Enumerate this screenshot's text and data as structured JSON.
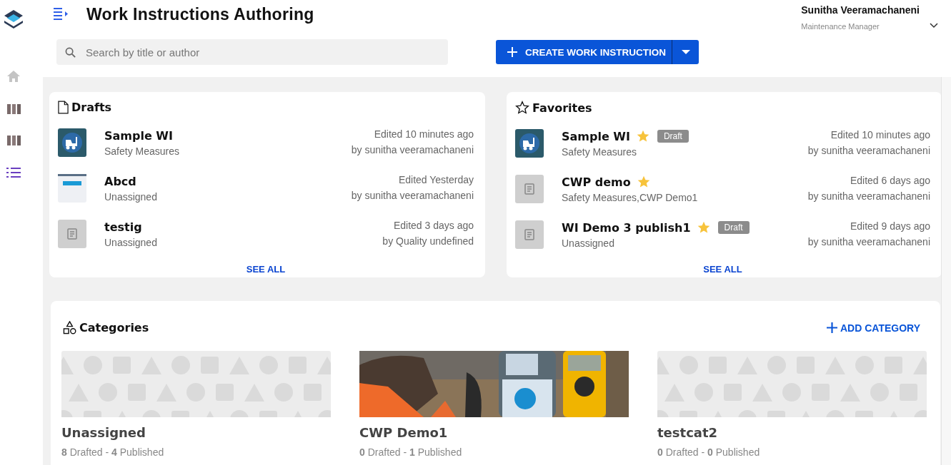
{
  "app": {
    "title": "Work Instructions Authoring"
  },
  "user": {
    "name": "Sunitha Veeramachaneni",
    "role": "Maintenance Manager"
  },
  "sidebar": [
    {
      "kind": "home",
      "selected": false
    },
    {
      "kind": "columns",
      "selected": false
    },
    {
      "kind": "columns",
      "selected": false
    },
    {
      "kind": "list",
      "selected": true
    }
  ],
  "search": {
    "placeholder": "Search by title or author"
  },
  "create_button": {
    "label": "CREATE WORK INSTRUCTION"
  },
  "drafts": {
    "title": "Drafts",
    "see_all": "SEE ALL",
    "items": [
      {
        "kind": "forklift",
        "name": "Sample WI",
        "category": "Safety Measures",
        "edited": "Edited 10 minutes ago",
        "author": "by sunitha veeramachaneni"
      },
      {
        "kind": "form",
        "name": "Abcd",
        "category": "Unassigned",
        "edited": "Edited Yesterday",
        "author": "by sunitha veeramachaneni"
      },
      {
        "kind": "document",
        "name": "testig",
        "category": "Unassigned",
        "edited": "Edited 3 days ago",
        "author": "by Quality undefined"
      }
    ]
  },
  "favorites": {
    "title": "Favorites",
    "see_all": "SEE ALL",
    "items": [
      {
        "kind": "forklift",
        "name": "Sample WI",
        "favorite": true,
        "badge": "Draft",
        "category": "Safety Measures",
        "edited": "Edited 10 minutes ago",
        "author": "by sunitha veeramachaneni"
      },
      {
        "kind": "document",
        "name": "CWP demo",
        "favorite": true,
        "category": "Safety Measures,CWP Demo1",
        "edited": "Edited 6 days ago",
        "author": "by sunitha veeramachaneni"
      },
      {
        "kind": "document",
        "name": "WI Demo 3 publish1",
        "favorite": true,
        "badge": "Draft",
        "category": "Unassigned",
        "edited": "Edited 9 days ago",
        "author": "by sunitha veeramachaneni"
      }
    ]
  },
  "categories": {
    "title": "Categories",
    "add_label": "ADD CATEGORY",
    "items": [
      {
        "kind": "pattern",
        "name": "Unassigned",
        "counts": "**8** Drafted - **4** Published"
      },
      {
        "kind": "picture",
        "name": "CWP Demo1",
        "counts": "**0** Drafted - **1** Published"
      },
      {
        "kind": "pattern",
        "name": "testcat2",
        "counts": "**0** Drafted - **0** Published"
      }
    ]
  }
}
